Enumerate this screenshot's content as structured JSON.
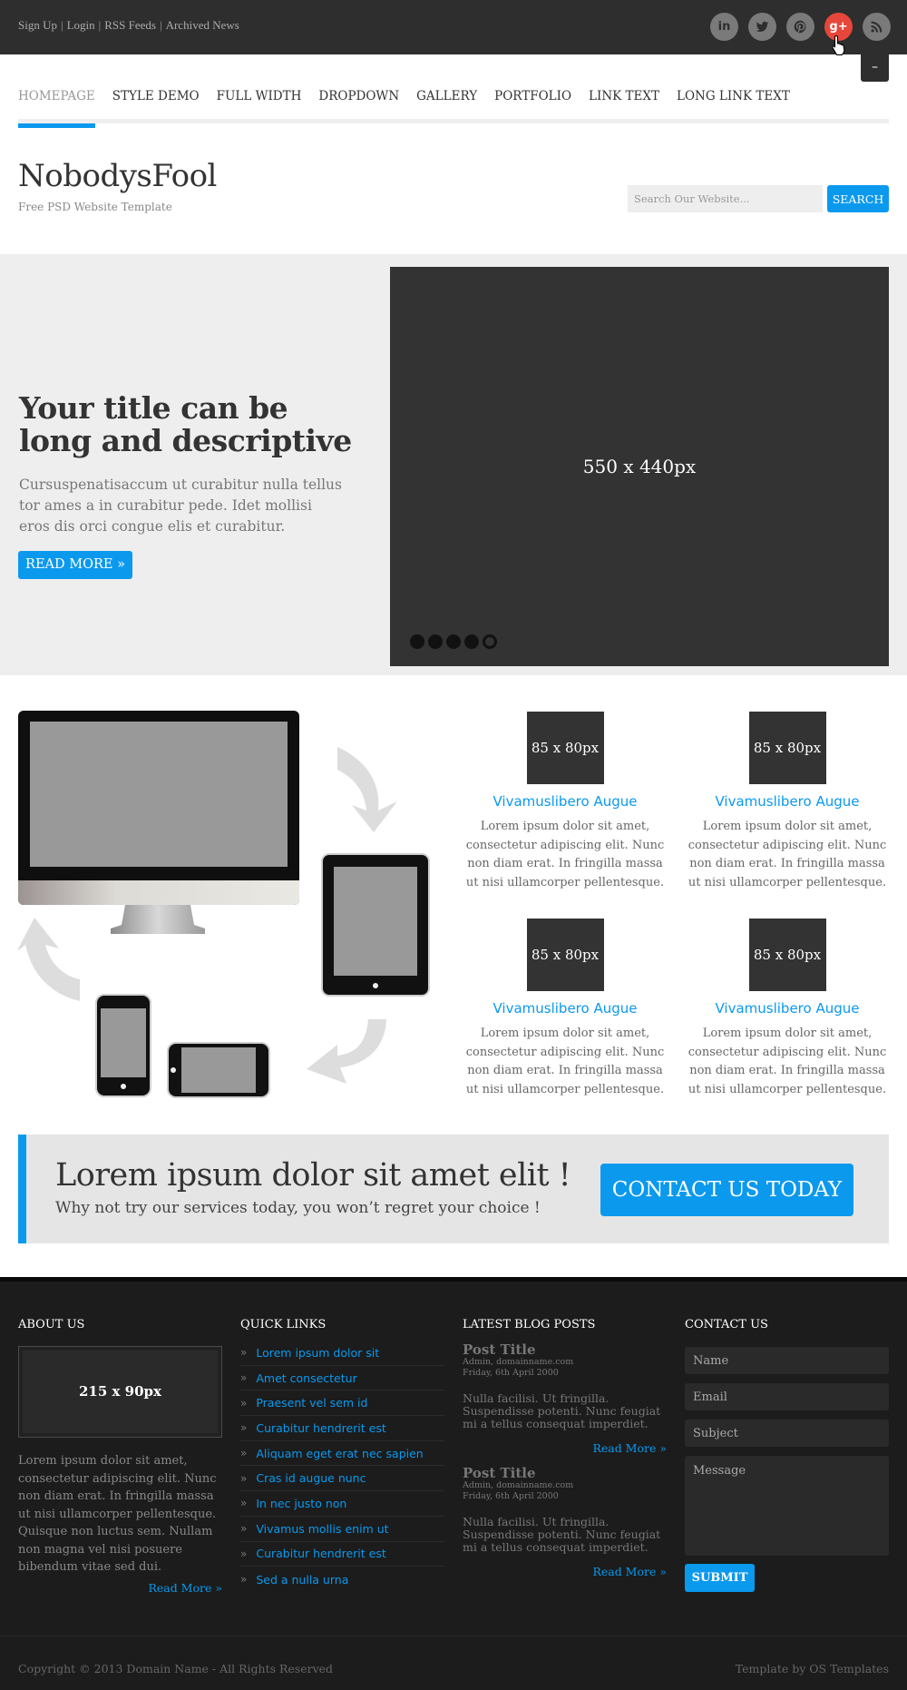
{
  "topbar": {
    "links": [
      "Sign Up",
      "Login",
      "RSS Feeds",
      "Archived News"
    ],
    "separator": "|",
    "socials": [
      {
        "name": "linkedin-icon",
        "glyph": "in"
      },
      {
        "name": "twitter-icon",
        "glyph": ""
      },
      {
        "name": "pinterest-icon",
        "glyph": ""
      },
      {
        "name": "google-plus-icon",
        "glyph": "g+"
      },
      {
        "name": "rss-icon",
        "glyph": ""
      }
    ],
    "active_social_color": "#e6473a",
    "menu_toggle": "–"
  },
  "nav": {
    "items": [
      "Homepage",
      "Style Demo",
      "Full Width",
      "Dropdown",
      "Gallery",
      "Portfolio",
      "Link Text",
      "Long Link Text"
    ],
    "active_index": 0
  },
  "header": {
    "logo": "NobodysFool",
    "tagline": "Free PSD Website Template",
    "search_placeholder": "Search Our Website...",
    "search_button": "SEARCH"
  },
  "hero": {
    "title": "Your title can be long and descriptive",
    "text": "Cursuspenatisaccum ut curabitur nulla tellus tor ames a in curabitur pede. Idet mollisi eros dis orci congue elis et curabitur.",
    "button": "READ MORE »",
    "image_label": "550 x 440px",
    "slides": 5,
    "active_slide": 4
  },
  "services": [
    {
      "thumb": "85 x 80px",
      "title": "Vivamuslibero Augue",
      "text": "Lorem ipsum dolor sit amet, consectetur adipiscing elit. Nunc non diam erat. In fringilla massa ut nisi ullamcorper pellentesque."
    },
    {
      "thumb": "85 x 80px",
      "title": "Vivamuslibero Augue",
      "text": "Lorem ipsum dolor sit amet, consectetur adipiscing elit. Nunc non diam erat. In fringilla massa ut nisi ullamcorper pellentesque."
    },
    {
      "thumb": "85 x 80px",
      "title": "Vivamuslibero Augue",
      "text": "Lorem ipsum dolor sit amet, consectetur adipiscing elit. Nunc non diam erat. In fringilla massa ut nisi ullamcorper pellentesque."
    },
    {
      "thumb": "85 x 80px",
      "title": "Vivamuslibero Augue",
      "text": "Lorem ipsum dolor sit amet, consectetur adipiscing elit. Nunc non diam erat. In fringilla massa ut nisi ullamcorper pellentesque."
    }
  ],
  "cta": {
    "title": "Lorem ipsum dolor sit amet elit !",
    "subtitle": "Why not try our services today, you won’t regret your choice !",
    "button": "CONTACT US TODAY"
  },
  "footer": {
    "about": {
      "heading": "ABOUT US",
      "image_label": "215 x 90px",
      "text": "Lorem ipsum dolor sit amet, consectetur adipiscing elit. Nunc non diam erat. In fringilla massa ut nisi ullamcorper pellentesque. Quisque non luctus sem. Nullam non magna vel nisi posuere bibendum vitae sed dui.",
      "read_more": "Read More »"
    },
    "quick_links": {
      "heading": "QUICK LINKS",
      "items": [
        "Lorem ipsum dolor sit",
        "Amet consectetur",
        "Praesent vel sem id",
        "Curabitur hendrerit est",
        "Aliquam eget erat nec sapien",
        "Cras id augue nunc",
        "In nec justo non",
        "Vivamus mollis enim ut",
        "Curabitur hendrerit est",
        "Sed a nulla urna"
      ]
    },
    "blog": {
      "heading": "LATEST BLOG POSTS",
      "posts": [
        {
          "title": "Post Title",
          "author": "Admin, domainname.com",
          "date": "Friday, 6th April 2000",
          "text": "Nulla facilisi. Ut fringilla. Suspendisse potenti. Nunc feugiat mi a tellus consequat imperdiet.",
          "read_more": "Read More »"
        },
        {
          "title": "Post Title",
          "author": "Admin, domainname.com",
          "date": "Friday, 6th April 2000",
          "text": "Nulla facilisi. Ut fringilla. Suspendisse potenti. Nunc feugiat mi a tellus consequat imperdiet.",
          "read_more": "Read More »"
        }
      ]
    },
    "contact": {
      "heading": "CONTACT US",
      "name_placeholder": "Name",
      "email_placeholder": "Email",
      "subject_placeholder": "Subject",
      "message_placeholder": "Message",
      "submit": "SUBMIT"
    }
  },
  "bottom": {
    "copyright": "Copyright © 2013 Domain Name - All Rights Reserved",
    "credit": "Template by OS Templates"
  },
  "colors": {
    "accent": "#0b99ee",
    "dark": "#2e2e2e",
    "footer": "#1c1c1c"
  }
}
